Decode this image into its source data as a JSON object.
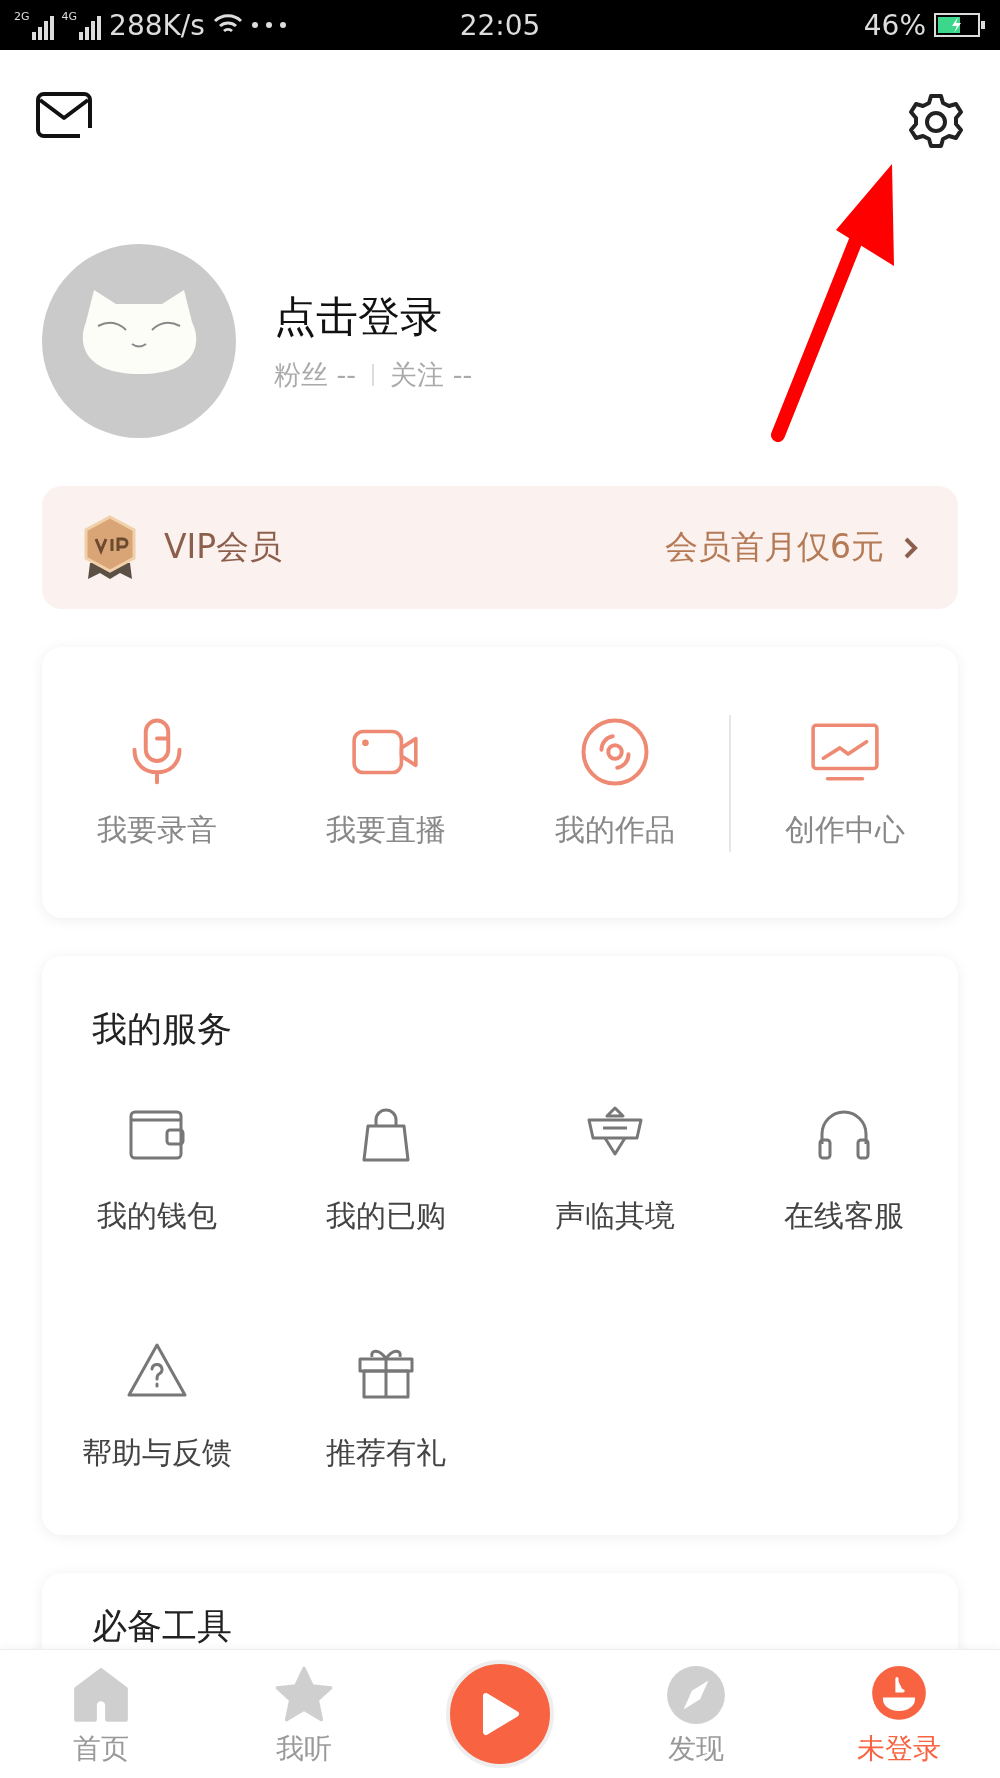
{
  "status_bar": {
    "network_speed": "288K/s",
    "time": "22:05",
    "battery": "46%",
    "signals": [
      {
        "label": "2G"
      },
      {
        "label": "4G"
      }
    ]
  },
  "profile": {
    "login": "点击登录",
    "stats": [
      {
        "label": "粉丝 --"
      },
      {
        "label": "关注 --"
      }
    ]
  },
  "vip": {
    "title": "VIP会员",
    "promo": "会员首月仅6元"
  },
  "quick_actions": [
    {
      "kind": "mic",
      "label": "我要录音"
    },
    {
      "kind": "camera",
      "label": "我要直播"
    },
    {
      "kind": "disc",
      "label": "我的作品"
    },
    {
      "kind": "monitor",
      "label": "创作中心"
    }
  ],
  "services": {
    "title": "我的服务",
    "items": [
      {
        "kind": "wallet",
        "label": "我的钱包"
      },
      {
        "kind": "bag",
        "label": "我的已购"
      },
      {
        "kind": "stage",
        "label": "声临其境"
      },
      {
        "kind": "headset",
        "label": "在线客服"
      },
      {
        "kind": "help",
        "label": "帮助与反馈"
      },
      {
        "kind": "gift",
        "label": "推荐有礼"
      }
    ]
  },
  "tools": {
    "title": "必备工具"
  },
  "tab_bar": [
    {
      "kind": "home",
      "label": "首页",
      "selected": false
    },
    {
      "kind": "star",
      "label": "我听",
      "selected": false
    },
    {
      "kind": "play"
    },
    {
      "kind": "compass",
      "label": "发现",
      "selected": false
    },
    {
      "kind": "user",
      "label": "未登录",
      "selected": true
    }
  ]
}
